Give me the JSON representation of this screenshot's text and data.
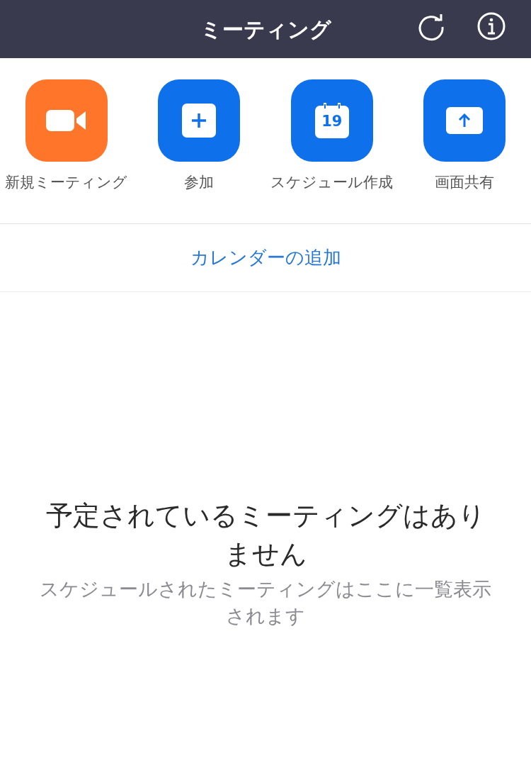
{
  "header": {
    "title": "ミーティング"
  },
  "actions": [
    {
      "kind": "video",
      "label": "新規ミーティング",
      "color": "#ff7529"
    },
    {
      "kind": "plus",
      "label": "参加",
      "color": "#0e71eb"
    },
    {
      "kind": "calendar",
      "label": "スケジュール作成",
      "color": "#0e71eb",
      "day": "19"
    },
    {
      "kind": "share",
      "label": "画面共有",
      "color": "#0e71eb"
    }
  ],
  "calendar_link": "カレンダーの追加",
  "empty_state": {
    "title": "予定されているミーティングはありません",
    "message": "スケジュールされたミーティングはここに一覧表示されます"
  }
}
